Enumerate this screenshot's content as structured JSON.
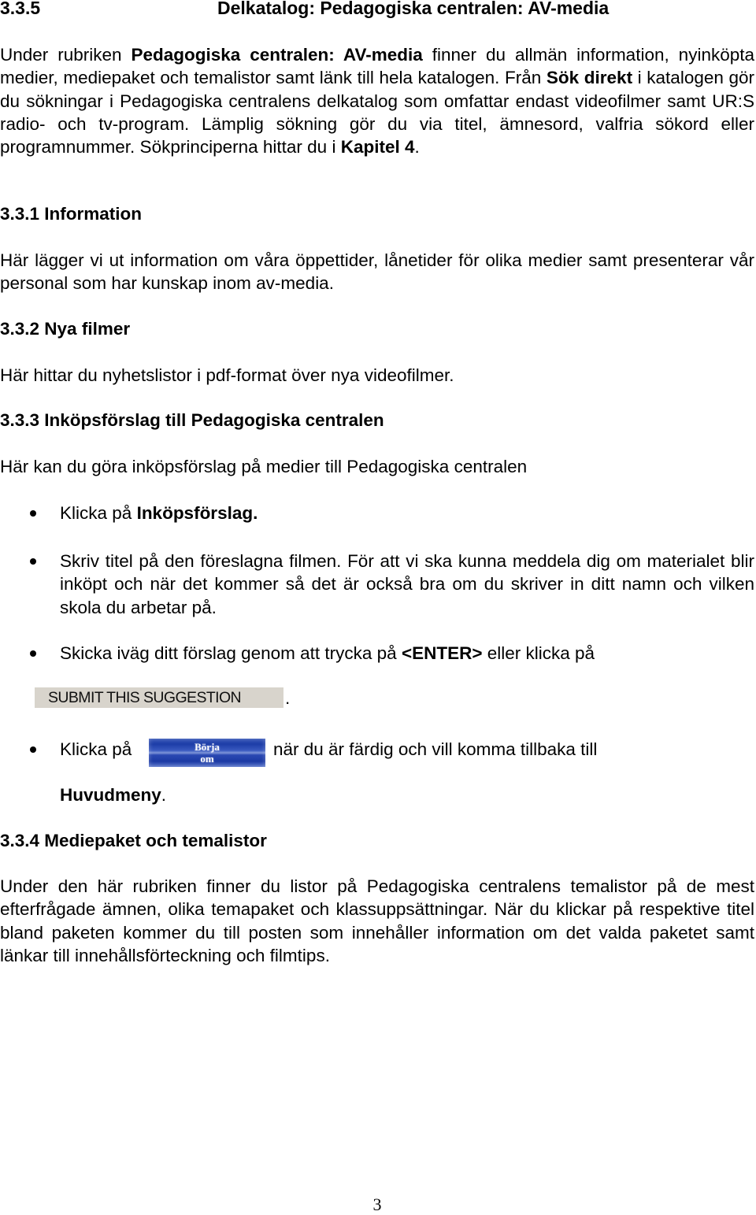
{
  "heading_main": {
    "number": "3.3.5",
    "title": "Delkatalog: Pedagogiska centralen: AV-media"
  },
  "intro": {
    "t1": "Under rubriken ",
    "b1": "Pedagogiska centralen: AV-media",
    "t2": " finner du allmän information, nyinköpta medier, mediepaket och temalistor samt länk till hela katalogen. Från ",
    "b2": "Sök direkt",
    "t3": " i katalogen gör du sökningar i Pedagogiska centralens delkatalog som omfattar endast videofilmer samt UR:S radio- och tv-program. Lämplig sökning gör du via titel, ämnesord, valfria sökord eller programnummer. Sökprinciperna hittar du i ",
    "b3": "Kapitel 4",
    "t4": "."
  },
  "sections": {
    "information": {
      "heading": "3.3.1 Information",
      "body": "Här lägger vi ut information om våra öppettider, lånetider för olika medier samt presenterar vår personal som har kunskap inom av-media."
    },
    "nya_filmer": {
      "heading": "3.3.2 Nya filmer",
      "body": "Här hittar du nyhetslistor i pdf-format över nya videofilmer."
    },
    "inkopsforslag": {
      "heading": "3.3.3 Inköpsförslag till Pedagogiska centralen",
      "body": "Här kan du göra inköpsförslag på medier till Pedagogiska centralen",
      "bullets": [
        {
          "t1": "Klicka på ",
          "b1": "Inköpsförslag."
        },
        {
          "t1": "Skriv titel på den föreslagna filmen. För att vi ska kunna meddela dig om materialet blir inköpt och när det kommer så det är också bra om du skriver in ditt namn och vilken skola du arbetar på."
        },
        {
          "t1": "Skicka iväg ditt förslag genom att trycka på ",
          "b1": "<ENTER>",
          "t2": " eller klicka på"
        },
        {
          "t1": "Klicka på",
          "t2": "när du är färdig och vill komma tillbaka till",
          "b1": "Huvudmeny",
          "t3": "."
        }
      ],
      "submit_button": "SUBMIT THIS SUGGESTION",
      "submit_trailing": ".",
      "borja_button": {
        "line1": "Börja",
        "line2": "om"
      }
    },
    "mediepaket": {
      "heading": "3.3.4 Mediepaket och temalistor",
      "body": "Under den här rubriken finner du listor på Pedagogiska centralens temalistor på de mest efterfrågade ämnen, olika temapaket och klassuppsättningar. När du klickar på respektive titel bland paketen kommer du till posten som innehåller information om det valda paketet samt länkar till innehållsförteckning och filmtips."
    }
  },
  "page_number": "3"
}
